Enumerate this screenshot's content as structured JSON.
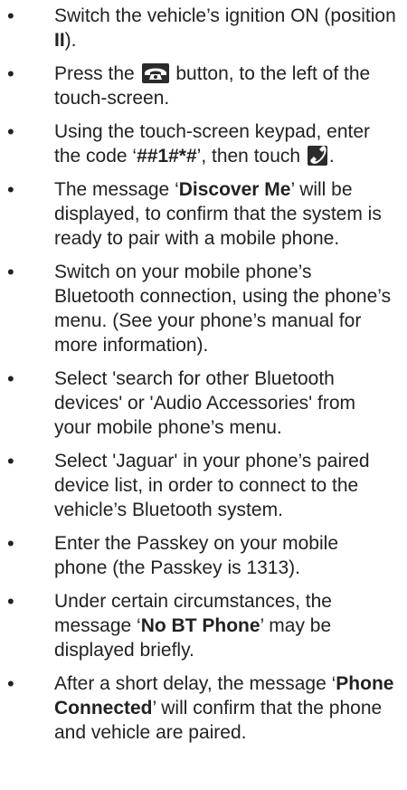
{
  "steps": [
    {
      "a": "Switch the vehicle’s ignition ON (position ",
      "b": "II",
      "c": ")."
    },
    {
      "a": "Press the ",
      "icon": "phone-receiver-icon",
      "c": " button, to the left of the touch-screen."
    },
    {
      "a": "Using the touch-screen keypad, enter the code ‘",
      "b": "##1#*#",
      "c": "’, then touch ",
      "icon": "handset-icon",
      "d": "."
    },
    {
      "a": "The message ‘",
      "b": "Discover Me",
      "c": "’ will be displayed, to confirm that the system is ready to pair with a mobile phone."
    },
    {
      "a": "Switch on your mobile phone’s Bluetooth connection, using the phone’s menu. (See your phone’s manual for more information)."
    },
    {
      "a": "Select 'search for other Bluetooth devices' or 'Audio Accessories' from your mobile phone’s menu."
    },
    {
      "a": "Select 'Jaguar' in your phone’s paired device list, in order to connect to the vehicle’s Bluetooth system."
    },
    {
      "a": "Enter the Passkey on your mobile phone (the Passkey is 1313)."
    },
    {
      "a": "Under certain circumstances, the message ‘",
      "b": "No BT Phone",
      "c": "’ may be displayed briefly."
    },
    {
      "a": "After a short delay, the message ‘",
      "b": "Phone Connected",
      "c": "’ will confirm that the phone and vehicle are paired."
    }
  ],
  "bullet_char": "•",
  "colors": {
    "text": "#222222",
    "icon_bg": "#2b2b2b",
    "icon_fg": "#ffffff"
  }
}
